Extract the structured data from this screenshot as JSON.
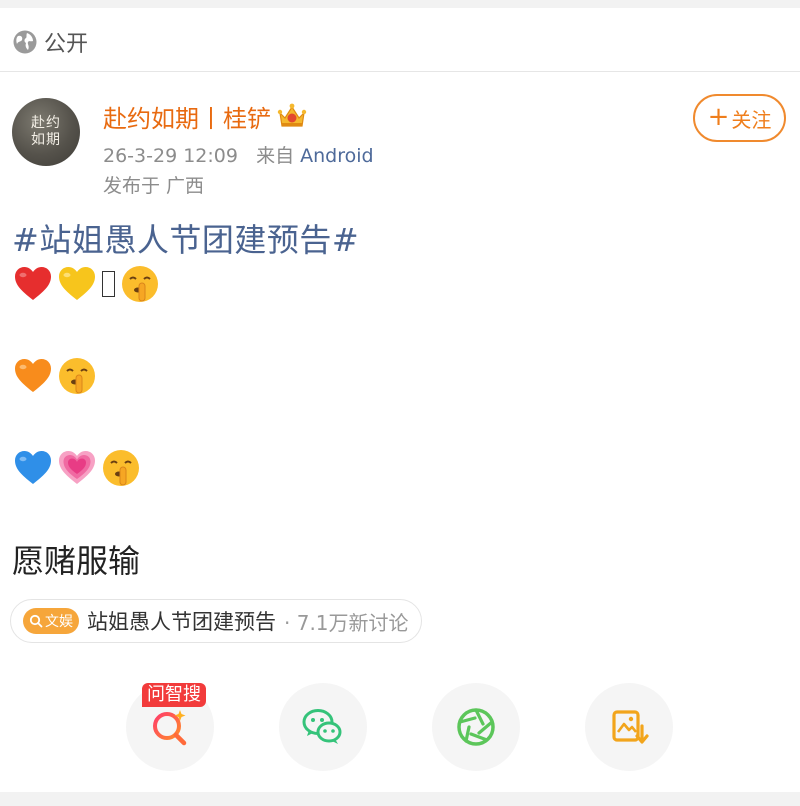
{
  "post": {
    "visibility": "公开",
    "author": {
      "name": "赴约如期丨桂铲",
      "avatar_text": "赴约如期"
    },
    "timestamp": "26-3-29 12:09",
    "source_prefix": "来自",
    "source": "Android",
    "location": "发布于 广西",
    "follow_label": "关注",
    "hashtag": "#站姐愚人节团建预告#",
    "emoji_lines": [
      [
        "red-heart",
        "yellow-heart",
        "missing-glyph",
        "shushing-face"
      ],
      [
        "orange-heart",
        "shushing-face"
      ],
      [
        "blue-heart",
        "growing-heart",
        "shushing-face"
      ]
    ],
    "closing_text": "愿赌服输",
    "topic": {
      "badge": "文娱",
      "title": "站姐愚人节团建预告",
      "count": "· 7.1万新讨论"
    }
  },
  "share": {
    "ask_tag": "问智搜",
    "buttons": [
      "ai-search",
      "wechat",
      "moments",
      "save-image"
    ]
  },
  "colors": {
    "author": "#e86a10",
    "hashtag": "#4a6390",
    "follow": "#ef7e1c",
    "ask_tag": "#f23b3b",
    "topic_badge": "#f6a63b"
  }
}
